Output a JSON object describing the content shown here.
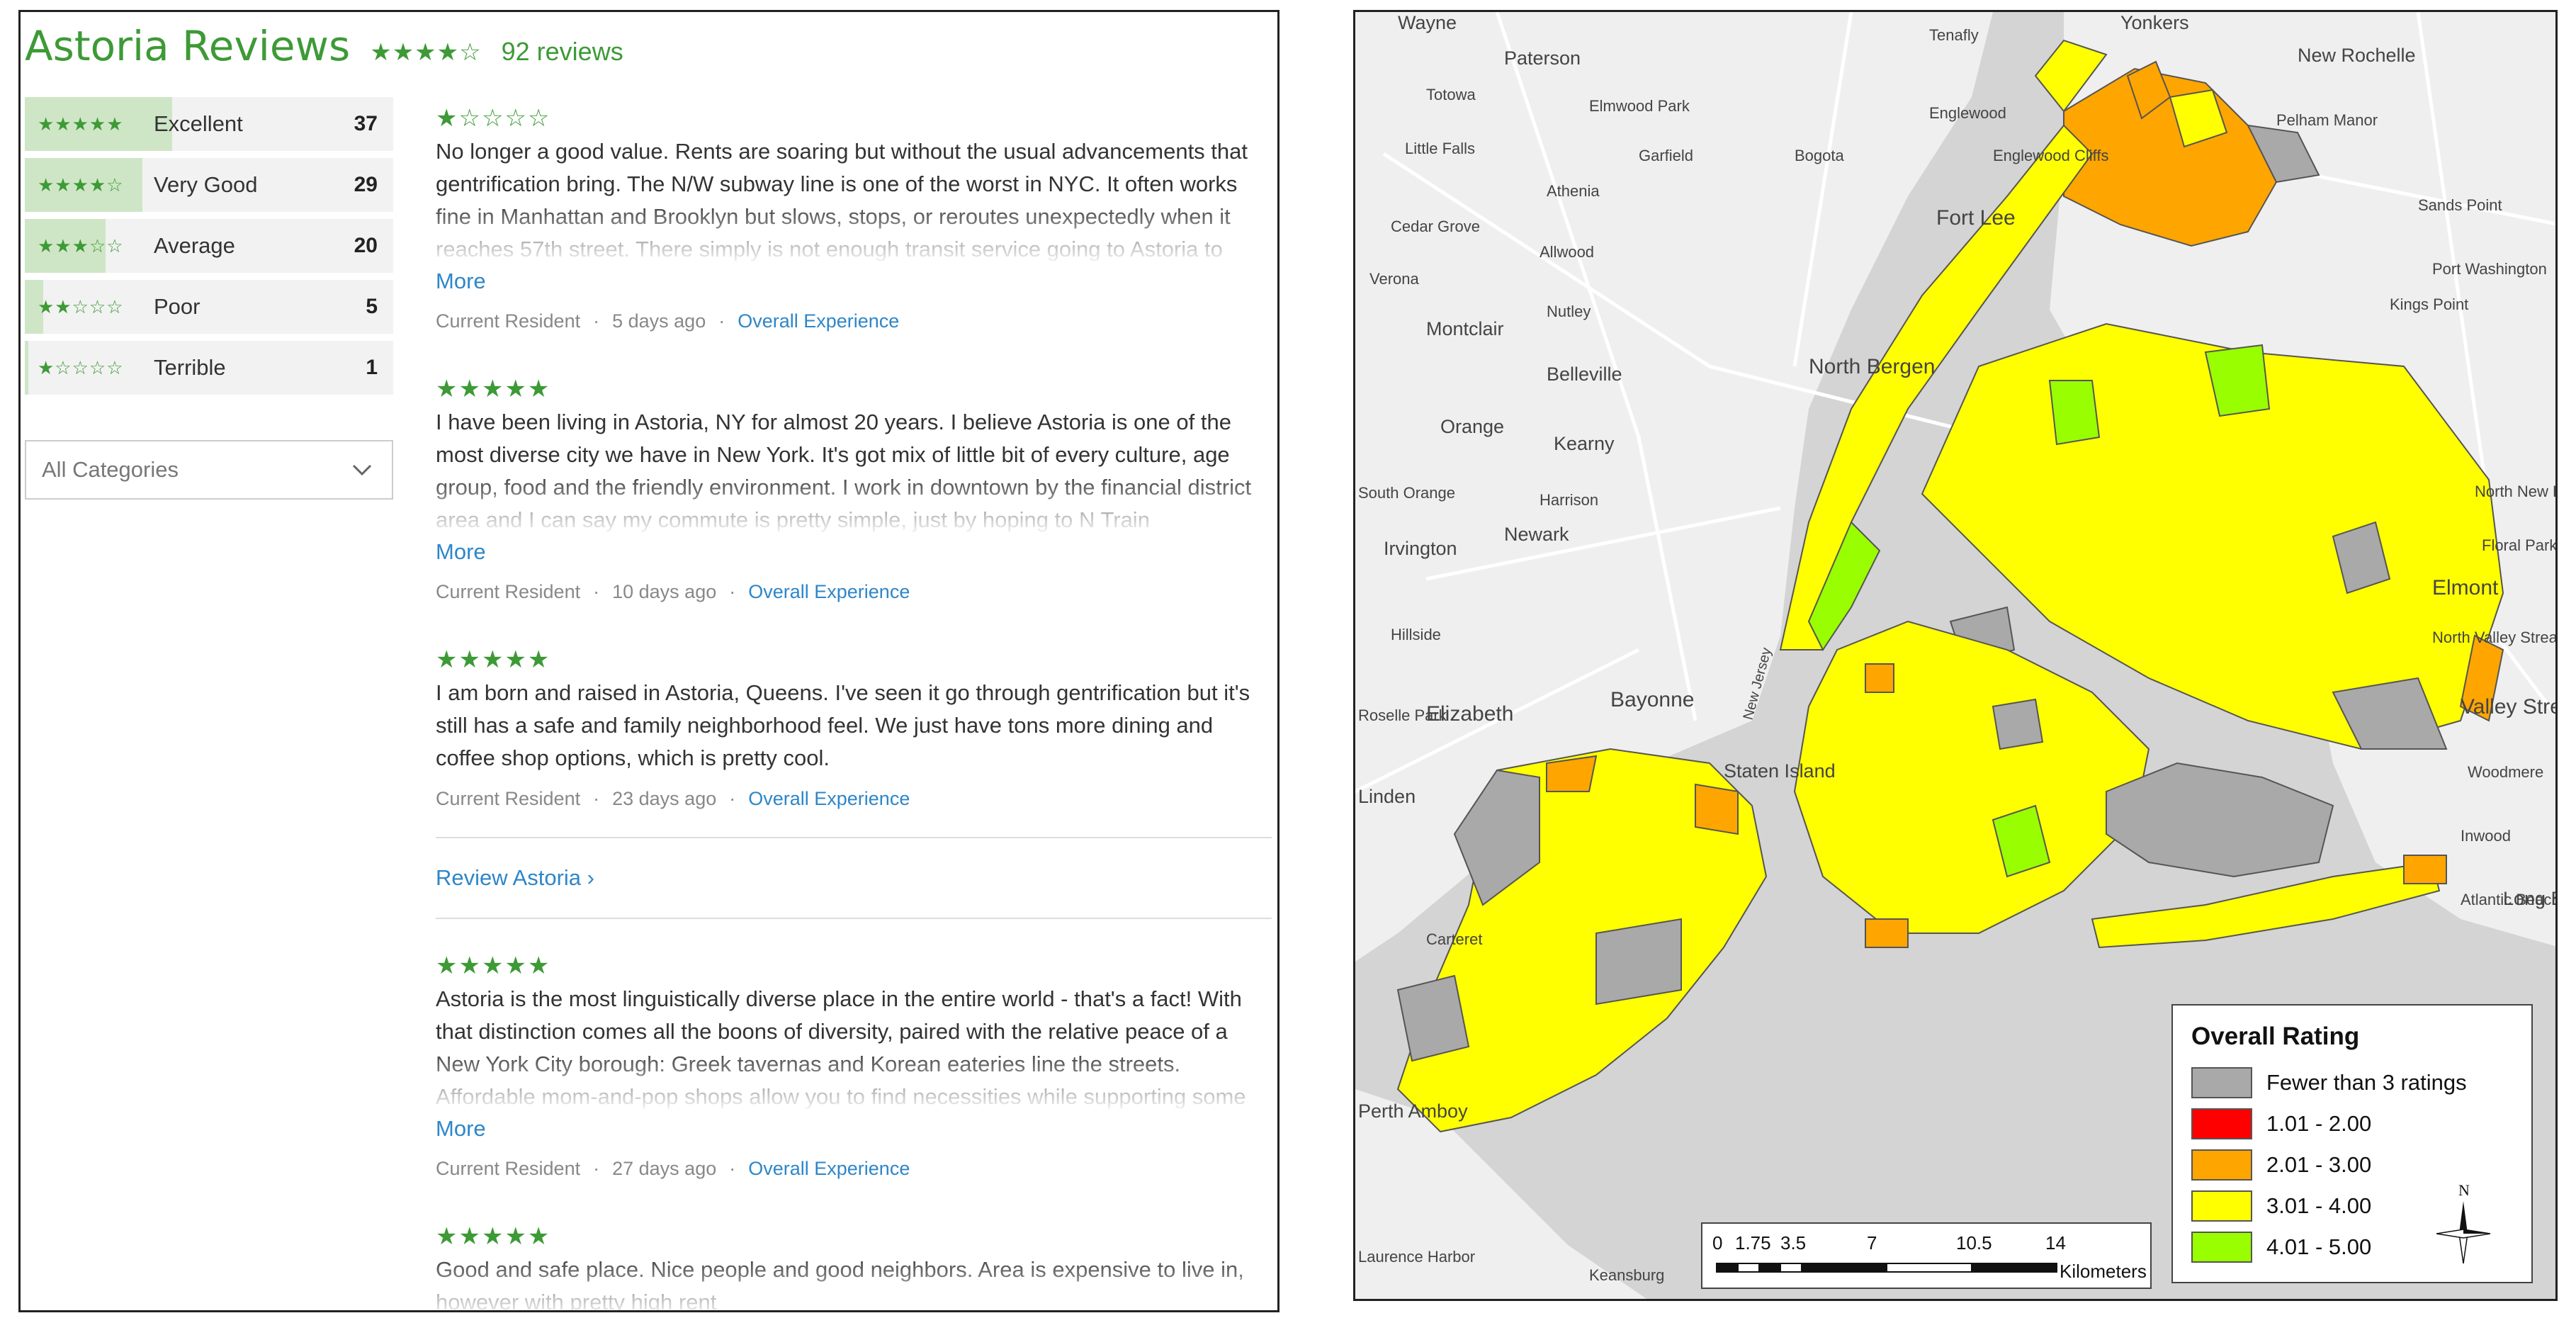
{
  "reviews_page": {
    "title": "Astoria Reviews",
    "overall_stars": "★★★★☆",
    "review_count": "92 reviews",
    "breakdown": [
      {
        "stars": "★★★★★",
        "label": "Excellent",
        "count": "37",
        "share": 0.4
      },
      {
        "stars": "★★★★☆",
        "label": "Very Good",
        "count": "29",
        "share": 0.32
      },
      {
        "stars": "★★★☆☆",
        "label": "Average",
        "count": "20",
        "share": 0.22
      },
      {
        "stars": "★★☆☆☆",
        "label": "Poor",
        "count": "5",
        "share": 0.05
      },
      {
        "stars": "★☆☆☆☆",
        "label": "Terrible",
        "count": "1",
        "share": 0.01
      }
    ],
    "category_filter": "All Categories",
    "reviews": [
      {
        "stars": "★☆☆☆☆",
        "text": "No longer a good value. Rents are soaring but without the usual advancements that gentrification bring. The N/W subway line is one of the worst in NYC. It often works fine in Manhattan and Brooklyn but slows, stops, or reroutes unexpectedly when it reaches 57th street. There simply is not enough transit service going to Astoria to",
        "more": "More",
        "author": "Current Resident",
        "age": "5 days ago",
        "category": "Overall Experience"
      },
      {
        "stars": "★★★★★",
        "text": "I have been living in Astoria, NY for almost 20 years. I believe Astoria is one of the most diverse city we have in New York. It's got mix of little bit of every culture, age group, food and the friendly environment. I work in downtown by the financial district area and I can say my commute is pretty simple, just by hoping to N Train",
        "more": "More",
        "author": "Current Resident",
        "age": "10 days ago",
        "category": "Overall Experience"
      },
      {
        "stars": "★★★★★",
        "text": "I am born and raised in Astoria, Queens. I've seen it go through gentrification but it's still has a safe and family neighborhood feel. We just have tons more dining and coffee shop options, which is pretty cool.",
        "author": "Current Resident",
        "age": "23 days ago",
        "category": "Overall Experience"
      },
      {
        "stars": "★★★★★",
        "text": "Astoria is the most linguistically diverse place in the entire world - that's a fact! With that distinction comes all the boons of diversity, paired with the relative peace of a New York City borough: Greek tavernas and Korean eateries line the streets. Affordable mom-and-pop shops allow you to find necessities while supporting some",
        "more": "More",
        "author": "Current Resident",
        "age": "27 days ago",
        "category": "Overall Experience"
      },
      {
        "stars": "★★★★★",
        "text": "Good and safe place. Nice people and good neighbors. Area is expensive to live in, however with pretty high rent"
      }
    ],
    "review_cta": "Review Astoria ›"
  },
  "map": {
    "place_labels": [
      "Wayne",
      "Paterson",
      "Tenafly",
      "Yonkers",
      "New Rochelle",
      "Totowa",
      "Elmwood Park",
      "Englewood",
      "Pelham Manor",
      "Little Falls",
      "Garfield",
      "Bogota",
      "Englewood Cliffs",
      "Athenia",
      "Fort Lee",
      "Sands Point",
      "Cedar Grove",
      "Allwood",
      "Verona",
      "Port Washington",
      "Nutley",
      "Kings Point",
      "Montclair",
      "Belleville",
      "North Bergen",
      "Orange",
      "Kearny",
      "Harrison",
      "South Orange",
      "North New Hyde Park",
      "Irvington",
      "Newark",
      "Floral Park",
      "Elmont",
      "Hillside",
      "North Valley Stream",
      "Bayonne",
      "Elizabeth",
      "Roselle Park",
      "Valley Stream",
      "Woodmere",
      "Linden",
      "Inwood",
      "Atlantic Beach",
      "Long Beach",
      "Carteret",
      "Perth Amboy",
      "Keansburg",
      "Laurence Harbor",
      "New Jersey",
      "Staten Island"
    ],
    "legend": {
      "title": "Overall Rating",
      "items": [
        {
          "label": "Fewer than 3 ratings",
          "color": "#a9a9a9"
        },
        {
          "label": "1.01 - 2.00",
          "color": "#ff0000"
        },
        {
          "label": "2.01 - 3.00",
          "color": "#ffa500"
        },
        {
          "label": "3.01 - 4.00",
          "color": "#ffff00"
        },
        {
          "label": "4.01 - 5.00",
          "color": "#99ff00"
        }
      ]
    },
    "scalebar": {
      "ticks": [
        "0",
        "1.75",
        "3.5",
        "7",
        "10.5",
        "14"
      ],
      "unit": "Kilometers"
    },
    "north": "N",
    "colors": {
      "water": "#d4d4d4",
      "land": "#efefef",
      "gray": "#a9a9a9",
      "orange": "#ffa500",
      "yellow": "#ffff00",
      "green": "#99ff00"
    }
  }
}
